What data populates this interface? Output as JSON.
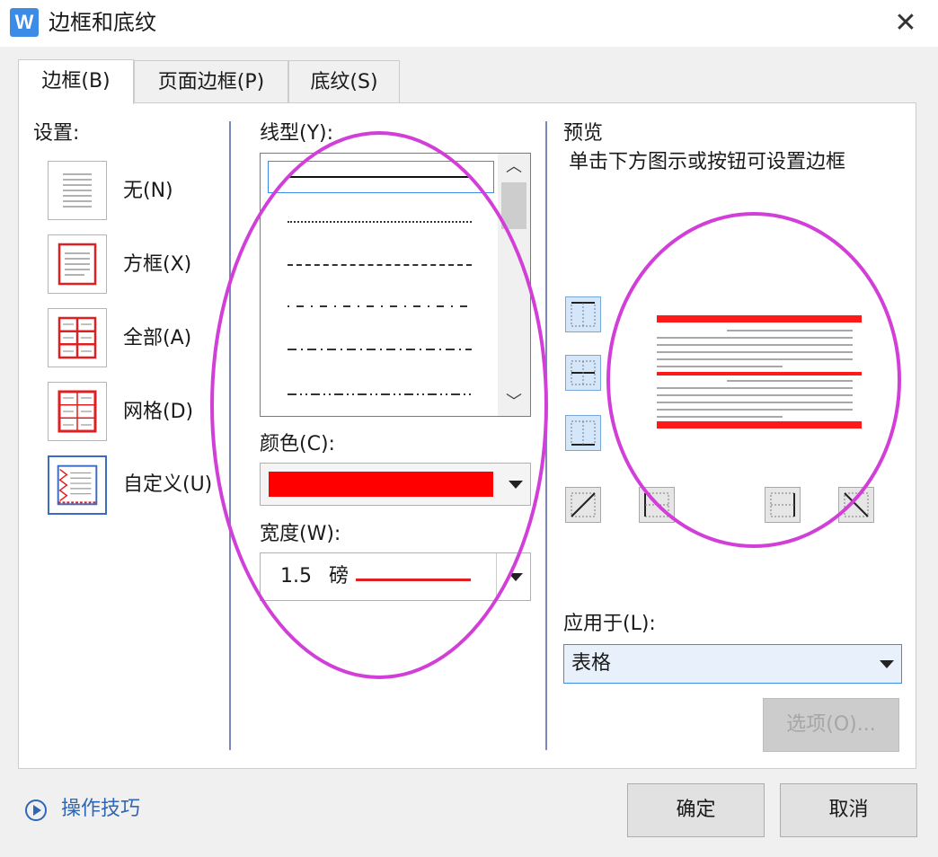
{
  "window": {
    "title": "边框和底纹",
    "app_icon": "W",
    "close_glyph": "✕"
  },
  "tabs": [
    {
      "label": "边框(B)",
      "active": true
    },
    {
      "label": "页面边框(P)",
      "active": false
    },
    {
      "label": "底纹(S)",
      "active": false
    }
  ],
  "settings": {
    "label": "设置:",
    "items": [
      {
        "label": "无(N)",
        "icon": "none-border-icon"
      },
      {
        "label": "方框(X)",
        "icon": "box-border-icon"
      },
      {
        "label": "全部(A)",
        "icon": "all-borders-icon"
      },
      {
        "label": "网格(D)",
        "icon": "grid-border-icon"
      },
      {
        "label": "自定义(U)",
        "icon": "custom-border-icon",
        "selected": true
      }
    ]
  },
  "style": {
    "line_type_label": "线型(Y):",
    "line_types": [
      "solid",
      "dotted",
      "dashed",
      "dash-small-gap",
      "dash-dot",
      "dash-dot-dot"
    ],
    "selected_line_type": "solid",
    "color_label": "颜色(C):",
    "color_value": "#ff0000",
    "width_label": "宽度(W):",
    "width_value": "1.5",
    "width_unit": "磅"
  },
  "preview": {
    "label": "预览",
    "hint": "单击下方图示或按钮可设置边框",
    "border_color": "#ff0000"
  },
  "apply_to": {
    "label": "应用于(L):",
    "value": "表格",
    "options_button": "选项(O)..."
  },
  "footer": {
    "tips_link": "操作技巧",
    "ok_button": "确定",
    "cancel_button": "取消"
  },
  "colors": {
    "accent": "#3c8ce7",
    "annotation": "#d23fd8",
    "link": "#2f66b5"
  }
}
